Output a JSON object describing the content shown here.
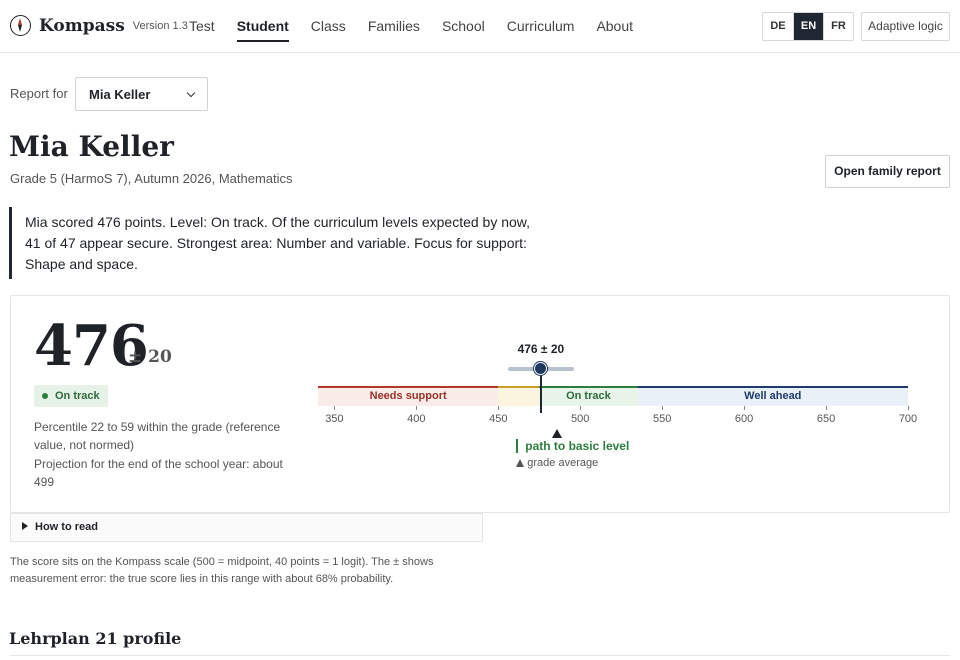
{
  "app": {
    "name": "Kompass",
    "version": "Version 1.3"
  },
  "nav": [
    {
      "label": "Test",
      "active": false
    },
    {
      "label": "Student",
      "active": true
    },
    {
      "label": "Class",
      "active": false
    },
    {
      "label": "Families",
      "active": false
    },
    {
      "label": "School",
      "active": false
    },
    {
      "label": "Curriculum",
      "active": false
    },
    {
      "label": "About",
      "active": false
    }
  ],
  "languages": [
    {
      "code": "DE",
      "selected": false
    },
    {
      "code": "EN",
      "selected": true
    },
    {
      "code": "FR",
      "selected": false
    }
  ],
  "adaptive_button": "Adaptive logic",
  "report_for": {
    "label": "Report for",
    "selected": "Mia Keller"
  },
  "student": {
    "name": "Mia Keller",
    "meta": "Grade 5 (HarmoS 7), Autumn 2026, Mathematics",
    "family_button": "Open family report"
  },
  "summary": "Mia scored 476 points. Level: On track. Of the curriculum levels expected by now, 41 of 47 appear secure. Strongest area: Number and variable. Focus for support: Shape and space.",
  "score": {
    "value": "476",
    "error": "± 20",
    "status": "On track",
    "percentile": "Percentile 22 to 59 within the grade (reference value, not normed)",
    "projection": "Projection for the end of the school year: about 499",
    "marker_label": "476 ± 20",
    "score_value": 476,
    "error_value": 20,
    "basic_path_label": "path to basic level",
    "basic_path_value": 450,
    "grade_average_label": "grade average",
    "grade_average_value": 486
  },
  "scale": {
    "min": 340,
    "max": 700,
    "ticks": [
      "350",
      "400",
      "450",
      "500",
      "550",
      "600",
      "650",
      "700"
    ],
    "bands": [
      {
        "label": "Needs support",
        "from": 340,
        "to": 450,
        "line": "#b03a2e",
        "fill": "#faece9",
        "text": "#9a3326"
      },
      {
        "label": "",
        "from": 450,
        "to": 475,
        "line": "#c9a227",
        "fill": "#fbf5e0",
        "text": "#7a6212"
      },
      {
        "label": "On track",
        "from": 475,
        "to": 535,
        "line": "#2e7d40",
        "fill": "#e8f4ea",
        "text": "#2e6b3a"
      },
      {
        "label": "Well ahead",
        "from": 535,
        "to": 700,
        "line": "#1f3a6f",
        "fill": "#eaf0f7",
        "text": "#1f3a6f"
      }
    ]
  },
  "how_to_read": "How to read",
  "scale_note": "The score sits on the Kompass scale (500 = midpoint, 40 points = 1 logit). The ± shows measurement error: the true score lies in this range with about 68% probability.",
  "section_heading": "Lehrplan 21 profile"
}
